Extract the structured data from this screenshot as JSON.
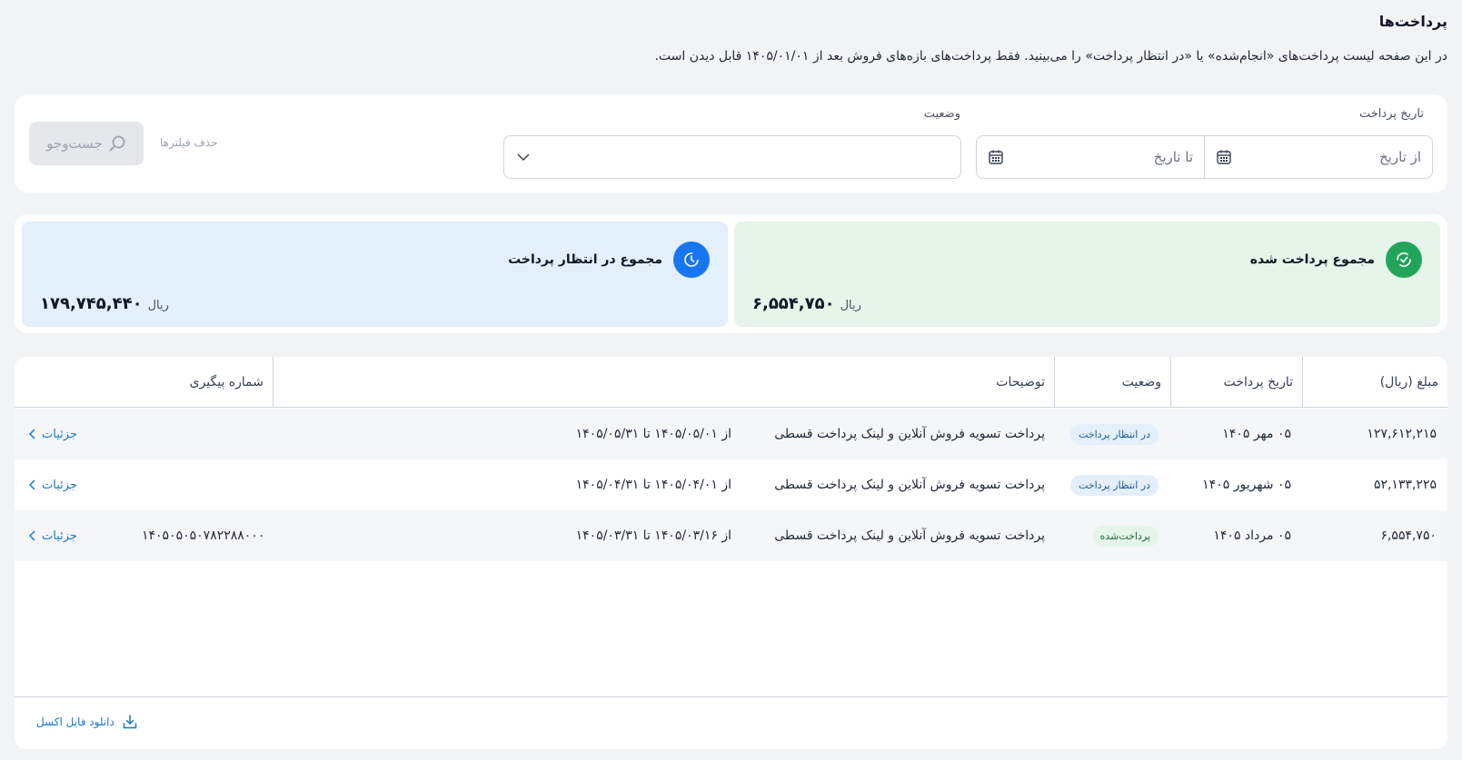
{
  "page": {
    "title": "پرداخت‌ها",
    "description": "در این صفحه لیست پرداخت‌های «انجام‌شده» یا «در انتظار پرداخت» را می‌بینید. فقط پرداخت‌های بازه‌های فروش بعد از ۱۴۰۵/۰۱/۰۱ قابل دیدن است."
  },
  "filters": {
    "date_label": "تاریخ پرداخت",
    "from_placeholder": "از تاریخ",
    "to_placeholder": "تا تاریخ",
    "status_label": "وضعیت",
    "status_value": "",
    "clear_label": "حذف فیلترها",
    "search_label": "جست‌وجو"
  },
  "summary": {
    "paid": {
      "title": "مجموع پرداخت شده",
      "amount": "۶,۵۵۴,۷۵۰",
      "currency": "ریال",
      "color": "#22a55a"
    },
    "pending": {
      "title": "مجموع در انتظار پرداخت",
      "amount": "۱۷۹,۷۴۵,۴۴۰",
      "currency": "ریال",
      "color": "#1976f2"
    }
  },
  "table": {
    "headers": {
      "amount": "مبلغ (ریال)",
      "date": "تاریخ پرداخت",
      "status": "وضعیت",
      "notes": "توضیحات",
      "tracking": "شماره پیگیری"
    },
    "rows": [
      {
        "amount": "۱۲۷,۶۱۲,۲۱۵",
        "date": "۰۵ مهر ۱۴۰۵",
        "status": "در انتظار پرداخت",
        "status_type": "pending",
        "note": "پرداخت تسویه فروش آنلاین و لینک پرداخت قسطی",
        "range": "از ۱۴۰۵/۰۵/۰۱ تا ۱۴۰۵/۰۵/۳۱",
        "tracking": "",
        "details": "جزئیات"
      },
      {
        "amount": "۵۲,۱۳۳,۲۲۵",
        "date": "۰۵ شهریور ۱۴۰۵",
        "status": "در انتظار پرداخت",
        "status_type": "pending",
        "note": "پرداخت تسویه فروش آنلاین و لینک پرداخت قسطی",
        "range": "از ۱۴۰۵/۰۴/۰۱ تا ۱۴۰۵/۰۴/۳۱",
        "tracking": "",
        "details": "جزئیات"
      },
      {
        "amount": "۶,۵۵۴,۷۵۰",
        "date": "۰۵ مرداد ۱۴۰۵",
        "status": "پرداخت‌شده",
        "status_type": "paid",
        "note": "پرداخت تسویه فروش آنلاین و لینک پرداخت قسطی",
        "range": "از ۱۴۰۵/۰۳/۱۶ تا ۱۴۰۵/۰۳/۳۱",
        "tracking": "۱۴۰۵۰۵۰۵۰۷۸۲۲۸۸۰۰۰",
        "details": "جزئیات"
      }
    ]
  },
  "footer": {
    "download_label": "دانلود فایل اکسل"
  }
}
